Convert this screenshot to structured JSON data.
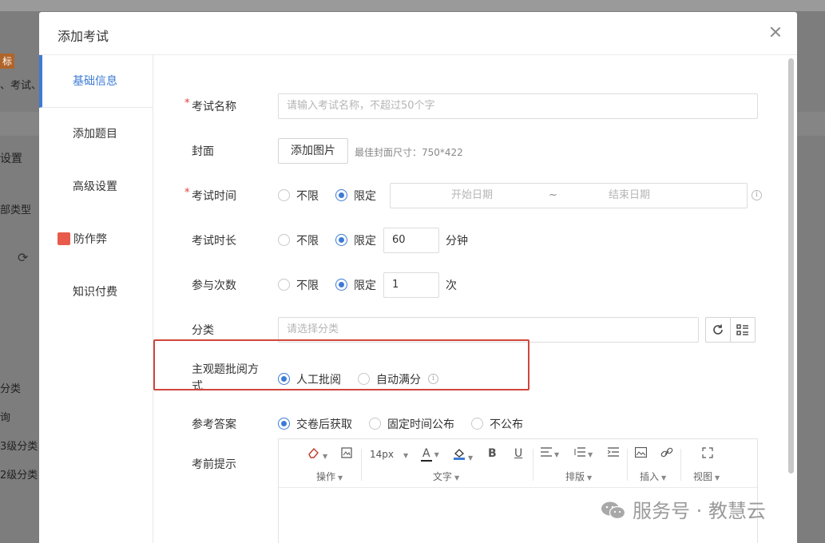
{
  "background": {
    "tag": "标",
    "line1": "、考试、",
    "settings": "设置",
    "type_filter": "部类型",
    "refresh": "⟳",
    "items": [
      "分类",
      "询",
      "3级分类",
      "2级分类"
    ]
  },
  "modal": {
    "title": "添加考试",
    "close_icon": "close-icon"
  },
  "nav": {
    "items": [
      {
        "label": "基础信息"
      },
      {
        "label": "添加题目"
      },
      {
        "label": "高级设置"
      },
      {
        "label": "防作弊"
      },
      {
        "label": "知识付费"
      }
    ]
  },
  "form": {
    "name": {
      "label": "考试名称",
      "placeholder": "请输入考试名称，不超过50个字"
    },
    "cover": {
      "label": "封面",
      "button": "添加图片",
      "hint": "最佳封面尺寸：750*422"
    },
    "time": {
      "label": "考试时间",
      "opt_unlimited": "不限",
      "opt_limited": "限定",
      "start_placeholder": "开始日期",
      "separator": "~",
      "end_placeholder": "结束日期"
    },
    "duration": {
      "label": "考试时长",
      "opt_unlimited": "不限",
      "opt_limited": "限定",
      "value": "60",
      "unit": "分钟"
    },
    "attempts": {
      "label": "参与次数",
      "opt_unlimited": "不限",
      "opt_limited": "限定",
      "value": "1",
      "unit": "次"
    },
    "category": {
      "label": "分类",
      "placeholder": "请选择分类"
    },
    "grading": {
      "label_line1": "主观题批阅方",
      "label_line2": "式",
      "opt_manual": "人工批阅",
      "opt_auto": "自动满分"
    },
    "answer": {
      "label": "参考答案",
      "opt_after": "交卷后获取",
      "opt_fixed": "固定时间公布",
      "opt_none": "不公布"
    },
    "tips": {
      "label": "考前提示"
    }
  },
  "editor": {
    "font_size": "14px",
    "groups": {
      "ops": "操作",
      "text": "文字",
      "layout": "排版",
      "insert": "插入",
      "view": "视图"
    },
    "bold": "B",
    "underline": "U",
    "font_color": "A"
  },
  "watermark": {
    "text": "服务号 · 教慧云"
  },
  "colors": {
    "accent": "#3c7bd6",
    "highlight": "#d0463d",
    "required": "#e03b3b"
  }
}
